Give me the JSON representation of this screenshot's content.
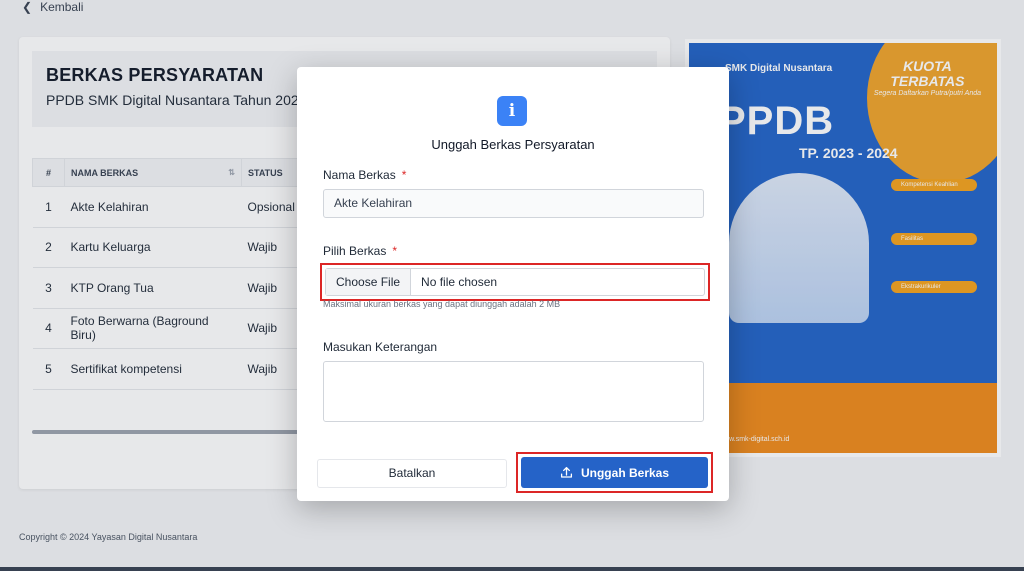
{
  "nav": {
    "back_label": "Kembali"
  },
  "card": {
    "title": "BERKAS PERSYARATAN",
    "subtitle": "PPDB SMK Digital Nusantara Tahun 2023/"
  },
  "table": {
    "headers": {
      "num": "#",
      "name": "NAMA BERKAS",
      "status": "STATUS"
    },
    "rows": [
      {
        "num": "1",
        "name": "Akte Kelahiran",
        "status": "Opsional"
      },
      {
        "num": "2",
        "name": "Kartu Keluarga",
        "status": "Wajib"
      },
      {
        "num": "3",
        "name": "KTP Orang Tua",
        "status": "Wajib"
      },
      {
        "num": "4",
        "name": "Foto Berwarna (Baground Biru)",
        "status": "Wajib"
      },
      {
        "num": "5",
        "name": "Sertifikat kompetensi",
        "status": "Wajib"
      }
    ]
  },
  "poster": {
    "brand": "SMK Digital Nusantara",
    "quota_line1": "KUOTA",
    "quota_line2": "TERBATAS",
    "quota_small": "Segera Daftarkan Putra/putri Anda",
    "big": "PPDB",
    "period": "TP. 2023 - 2024",
    "pill1": "Kompetensi Keahlian",
    "pill2": "Fasilitas",
    "pill3": "Ekstrakurikuler",
    "footer": "www.smk-digital.sch.id"
  },
  "modal": {
    "title": "Unggah Berkas Persyaratan",
    "name_label": "Nama Berkas",
    "name_value": "Akte Kelahiran",
    "file_label": "Pilih Berkas",
    "choose_label": "Choose File",
    "no_file": "No file chosen",
    "hint": "Maksimal ukuran berkas yang dapat diunggah adalah 2 MB",
    "note_label": "Masukan Keterangan",
    "note_value": "",
    "cancel_label": "Batalkan",
    "upload_label": "Unggah Berkas",
    "required_mark": "*"
  },
  "footer": {
    "copyright": "Copyright © 2024 Yayasan Digital Nusantara"
  },
  "colors": {
    "primary": "#2563c8",
    "danger": "#dc2626",
    "info": "#3b82f6"
  }
}
